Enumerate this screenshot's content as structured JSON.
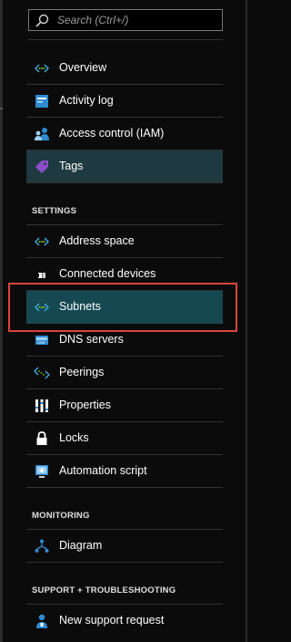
{
  "search": {
    "placeholder": "Search (Ctrl+/)"
  },
  "nav_top": [
    {
      "label": "Overview"
    },
    {
      "label": "Activity log"
    },
    {
      "label": "Access control (IAM)"
    },
    {
      "label": "Tags"
    }
  ],
  "sections": {
    "settings": "SETTINGS",
    "monitoring": "MONITORING",
    "support": "SUPPORT + TROUBLESHOOTING"
  },
  "settings_items": [
    {
      "label": "Address space"
    },
    {
      "label": "Connected devices"
    },
    {
      "label": "Subnets"
    },
    {
      "label": "DNS servers"
    },
    {
      "label": "Peerings"
    },
    {
      "label": "Properties"
    },
    {
      "label": "Locks"
    },
    {
      "label": "Automation script"
    }
  ],
  "monitoring_items": [
    {
      "label": "Diagram"
    }
  ],
  "support_items": [
    {
      "label": "New support request"
    }
  ],
  "colors": {
    "selected_bg": "#1e3a40",
    "subnets_bg": "#164852",
    "highlight": "#d9453d",
    "accent": "#2e8bd1"
  }
}
